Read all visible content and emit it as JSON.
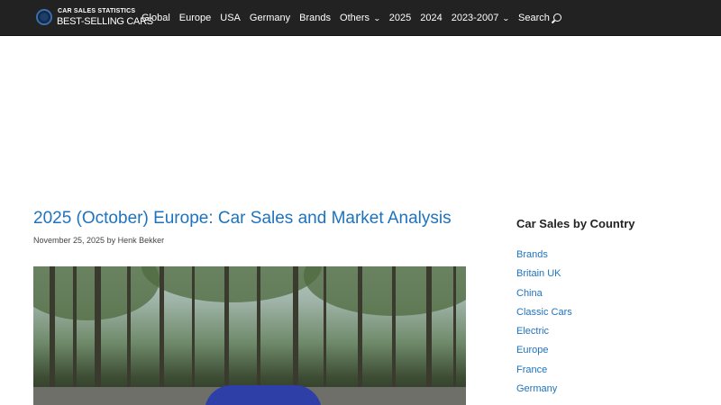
{
  "header": {
    "logo_top": "CAR SALES STATISTICS",
    "logo_bottom": "BEST-SELLING CARS",
    "nav": [
      {
        "label": "Global",
        "dropdown": false
      },
      {
        "label": "Europe",
        "dropdown": false
      },
      {
        "label": "USA",
        "dropdown": false
      },
      {
        "label": "Germany",
        "dropdown": false
      },
      {
        "label": "Brands",
        "dropdown": false
      },
      {
        "label": "Others",
        "dropdown": true
      },
      {
        "label": "2025",
        "dropdown": false
      },
      {
        "label": "2024",
        "dropdown": false
      },
      {
        "label": "2023-2007",
        "dropdown": true
      },
      {
        "label": "Search",
        "dropdown": false
      }
    ]
  },
  "article": {
    "title": "2025 (October) Europe: Car Sales and Market Analysis",
    "date": "November 25, 2025",
    "by": "by",
    "author": "Henk Bekker"
  },
  "sidebar": {
    "title": "Car Sales by Country",
    "items": [
      "Brands",
      "Britain UK",
      "China",
      "Classic Cars",
      "Electric",
      "Europe",
      "France",
      "Germany"
    ]
  },
  "colors": {
    "header_bg": "#222222",
    "link": "#1e73be",
    "car": "#2f3fa8"
  },
  "icons": {
    "logo": "globe-icon",
    "dropdown": "chevron-down-icon",
    "search": "search-icon"
  }
}
